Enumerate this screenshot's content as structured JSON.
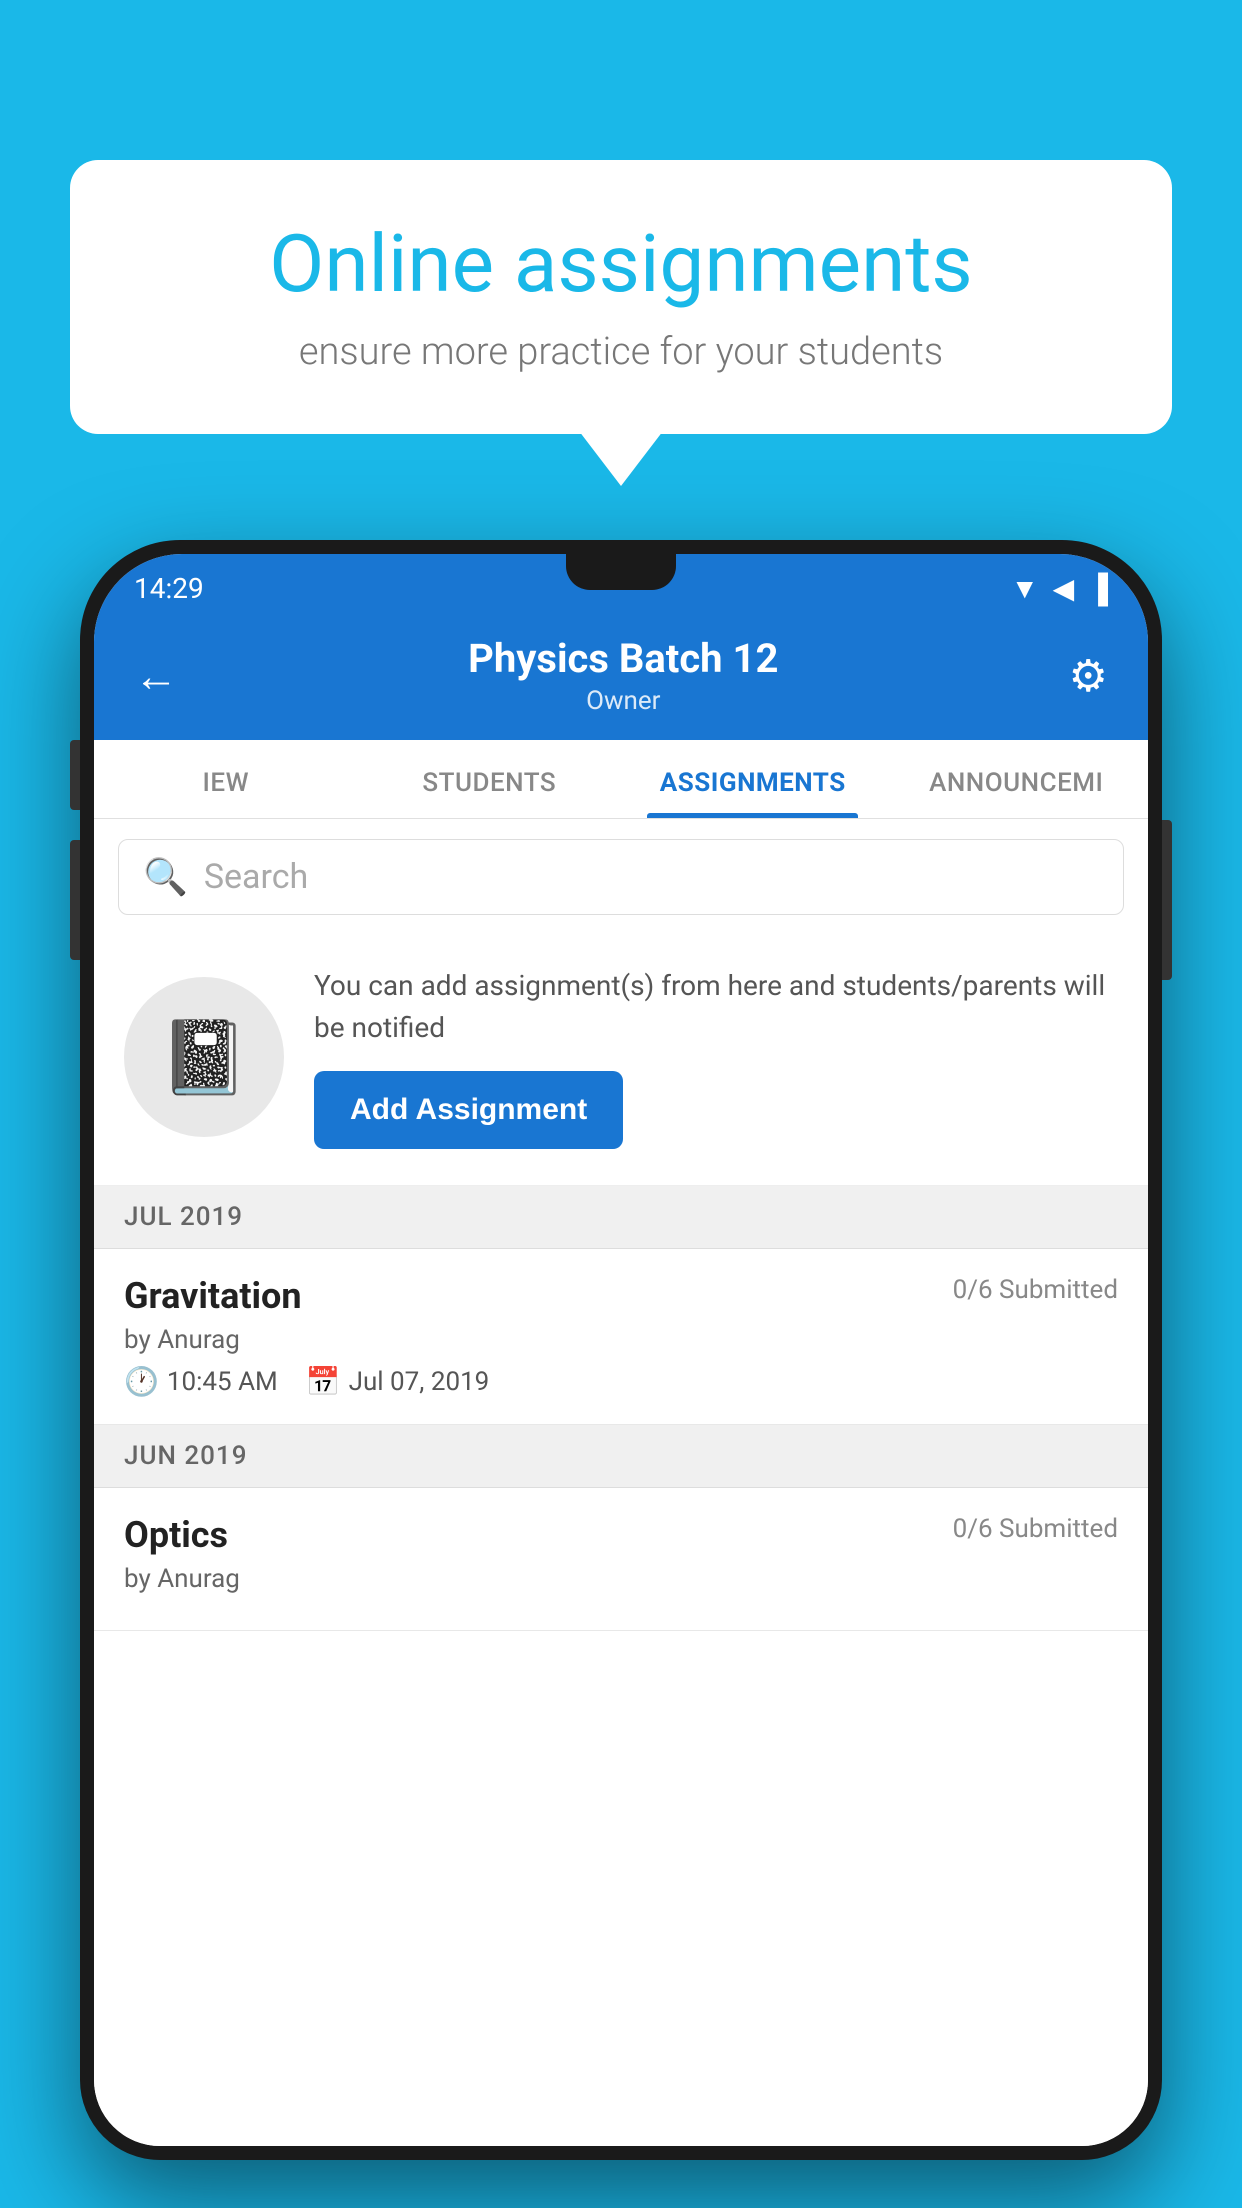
{
  "background_color": "#1ab8e8",
  "speech_bubble": {
    "heading": "Online assignments",
    "subtext": "ensure more practice for your students"
  },
  "status_bar": {
    "time": "14:29",
    "wifi": "▲",
    "signal": "▲",
    "battery": "▐"
  },
  "app_header": {
    "title": "Physics Batch 12",
    "subtitle": "Owner",
    "back_label": "←",
    "settings_label": "⚙"
  },
  "tabs": [
    {
      "label": "IEW",
      "active": false
    },
    {
      "label": "STUDENTS",
      "active": false
    },
    {
      "label": "ASSIGNMENTS",
      "active": true
    },
    {
      "label": "ANNOUNCEMENTS",
      "active": false
    }
  ],
  "search": {
    "placeholder": "Search",
    "icon": "🔍"
  },
  "promo": {
    "icon": "📓",
    "text": "You can add assignment(s) from here and students/parents will be notified",
    "button_label": "Add Assignment"
  },
  "months": [
    {
      "label": "JUL 2019",
      "assignments": [
        {
          "title": "Gravitation",
          "submitted": "0/6 Submitted",
          "author": "by Anurag",
          "time": "10:45 AM",
          "date": "Jul 07, 2019"
        }
      ]
    },
    {
      "label": "JUN 2019",
      "assignments": [
        {
          "title": "Optics",
          "submitted": "0/6 Submitted",
          "author": "by Anurag",
          "time": "",
          "date": ""
        }
      ]
    }
  ]
}
